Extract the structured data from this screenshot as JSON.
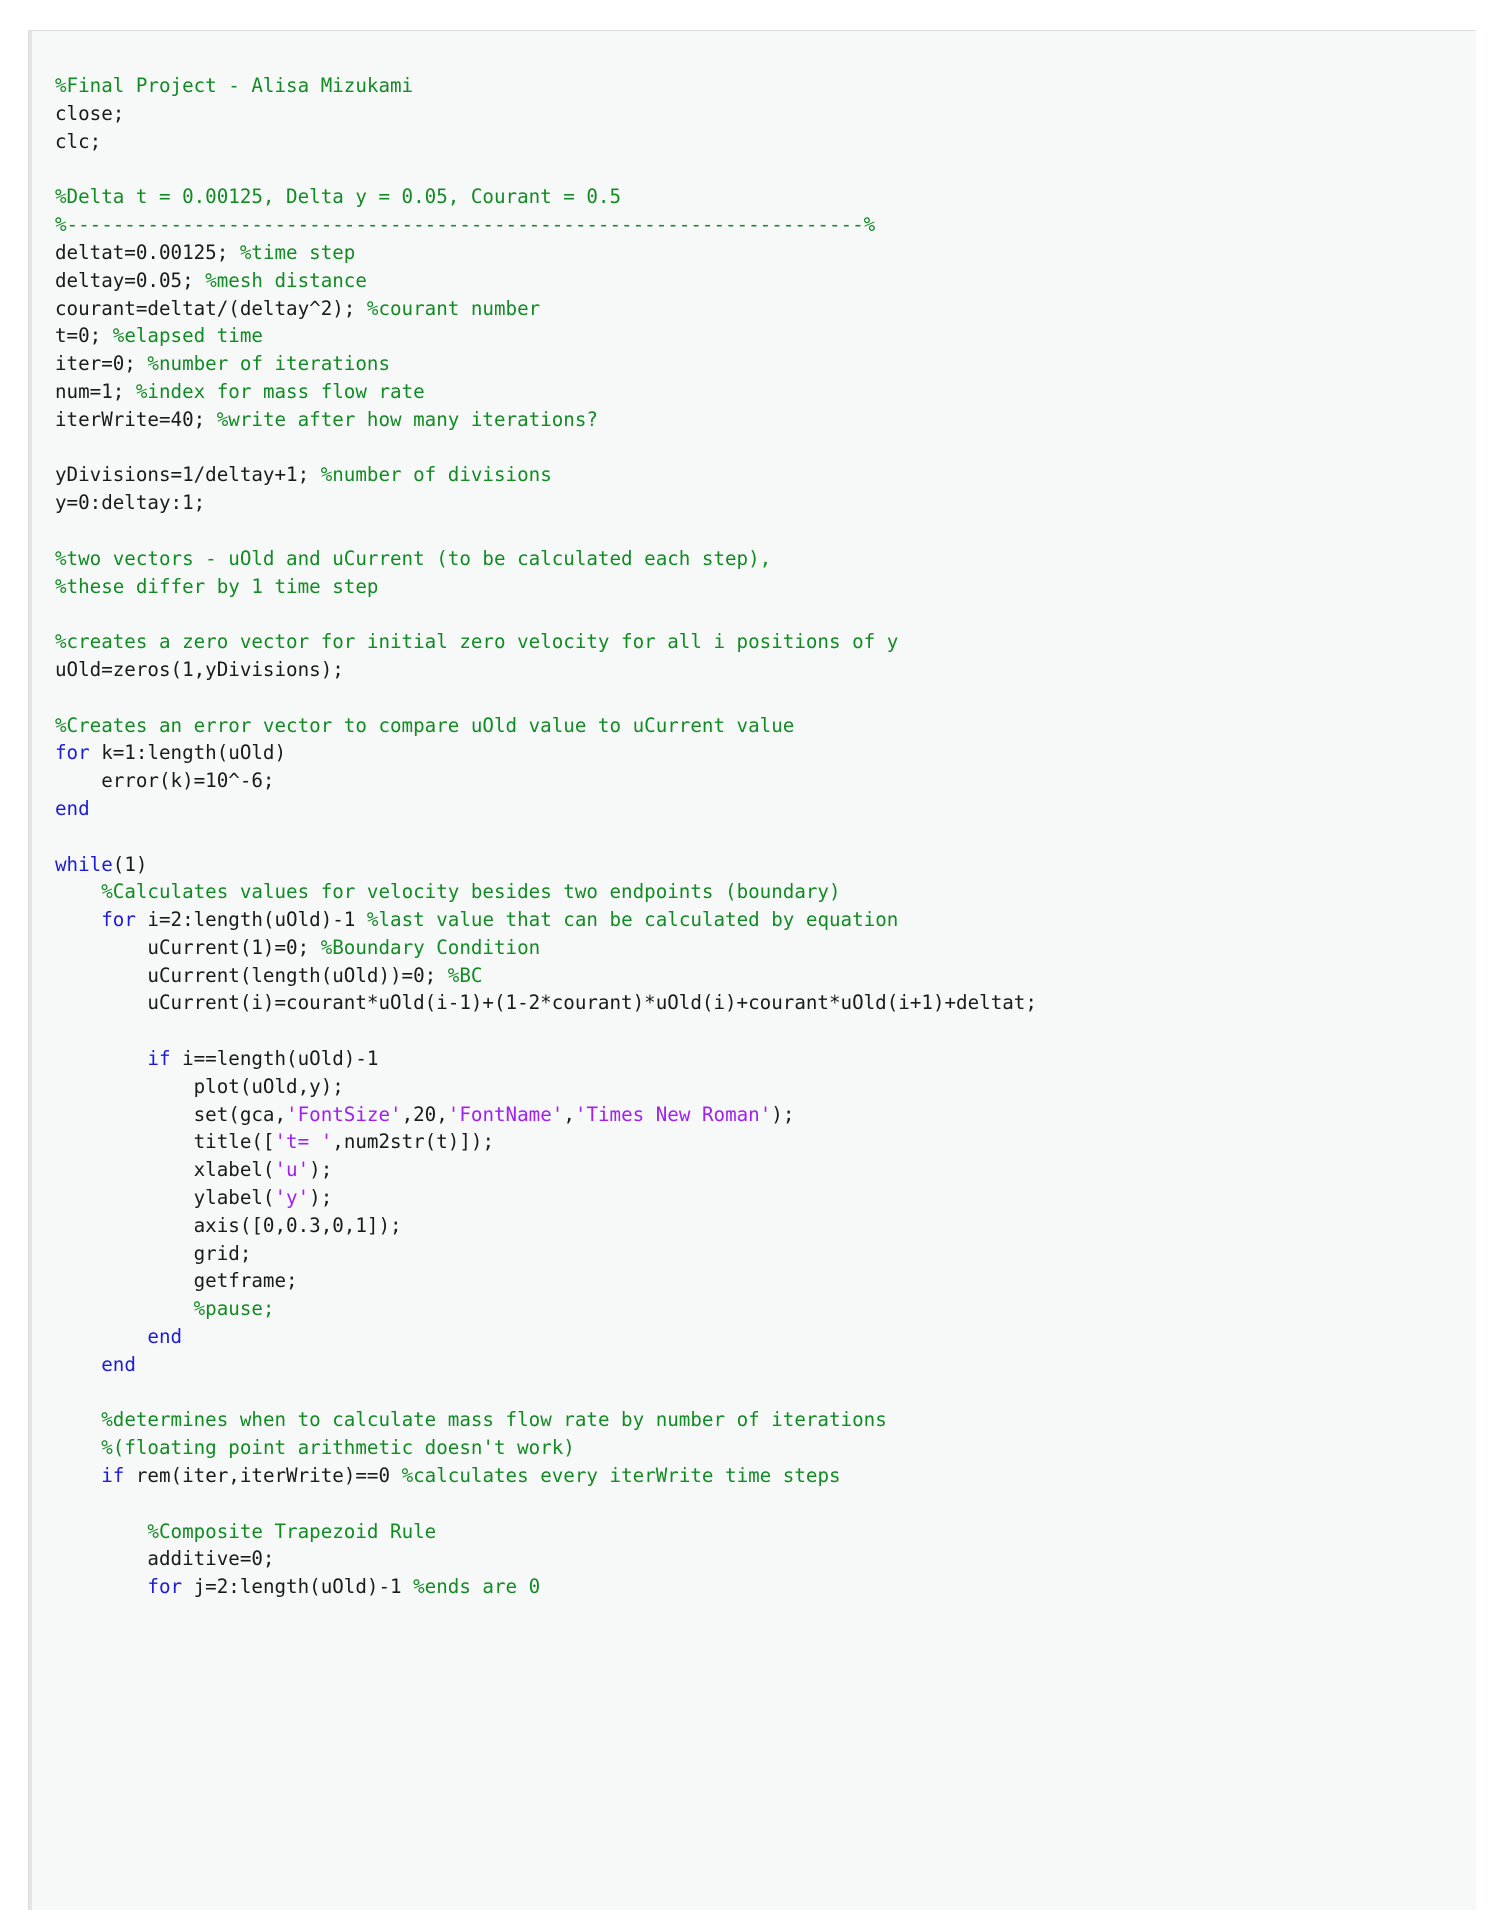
{
  "document": {
    "type": "matlab-code-listing",
    "language": "MATLAB",
    "title": "Final Project - Alisa Mizukami",
    "author": "Alisa Mizukami",
    "colors": {
      "page_background": "#f7f8f8",
      "outer_background": "#ffffff",
      "border": "#dcdddf",
      "comment": "#128b24",
      "keyword": "#1c1cd6",
      "string": "#a020f0",
      "plain": "#1a1a1a"
    }
  },
  "code": {
    "lines": [
      [
        {
          "t": "%Final Project - Alisa Mizukami",
          "c": "cm"
        }
      ],
      [
        {
          "t": "close;",
          "c": "pl"
        }
      ],
      [
        {
          "t": "clc;",
          "c": "pl"
        }
      ],
      [
        {
          "t": "",
          "c": "pl"
        }
      ],
      [
        {
          "t": "%Delta t = 0.00125, Delta y = 0.05, Courant = 0.5",
          "c": "cm"
        }
      ],
      [
        {
          "t": "%---------------------------------------------------------------------%",
          "c": "cm"
        }
      ],
      [
        {
          "t": "deltat=0.00125; ",
          "c": "pl"
        },
        {
          "t": "%time step",
          "c": "cm"
        }
      ],
      [
        {
          "t": "deltay=0.05; ",
          "c": "pl"
        },
        {
          "t": "%mesh distance",
          "c": "cm"
        }
      ],
      [
        {
          "t": "courant=deltat/(deltay^2); ",
          "c": "pl"
        },
        {
          "t": "%courant number",
          "c": "cm"
        }
      ],
      [
        {
          "t": "t=0; ",
          "c": "pl"
        },
        {
          "t": "%elapsed time",
          "c": "cm"
        }
      ],
      [
        {
          "t": "iter=0; ",
          "c": "pl"
        },
        {
          "t": "%number of iterations",
          "c": "cm"
        }
      ],
      [
        {
          "t": "num=1; ",
          "c": "pl"
        },
        {
          "t": "%index for mass flow rate",
          "c": "cm"
        }
      ],
      [
        {
          "t": "iterWrite=40; ",
          "c": "pl"
        },
        {
          "t": "%write after how many iterations?",
          "c": "cm"
        }
      ],
      [
        {
          "t": "",
          "c": "pl"
        }
      ],
      [
        {
          "t": "yDivisions=1/deltay+1; ",
          "c": "pl"
        },
        {
          "t": "%number of divisions",
          "c": "cm"
        }
      ],
      [
        {
          "t": "y=0:deltay:1;",
          "c": "pl"
        }
      ],
      [
        {
          "t": "",
          "c": "pl"
        }
      ],
      [
        {
          "t": "%two vectors - uOld and uCurrent (to be calculated each step),",
          "c": "cm"
        }
      ],
      [
        {
          "t": "%these differ by 1 time step",
          "c": "cm"
        }
      ],
      [
        {
          "t": "",
          "c": "pl"
        }
      ],
      [
        {
          "t": "%creates a zero vector for initial zero velocity for all i positions of y",
          "c": "cm"
        }
      ],
      [
        {
          "t": "uOld=zeros(1,yDivisions);",
          "c": "pl"
        }
      ],
      [
        {
          "t": "",
          "c": "pl"
        }
      ],
      [
        {
          "t": "%Creates an error vector to compare uOld value to uCurrent value",
          "c": "cm"
        }
      ],
      [
        {
          "t": "for",
          "c": "kw"
        },
        {
          "t": " k=1:length(uOld)",
          "c": "pl"
        }
      ],
      [
        {
          "t": "    error(k)=10^-6;",
          "c": "pl"
        }
      ],
      [
        {
          "t": "end",
          "c": "kw"
        }
      ],
      [
        {
          "t": "",
          "c": "pl"
        }
      ],
      [
        {
          "t": "while",
          "c": "kw"
        },
        {
          "t": "(1)",
          "c": "pl"
        }
      ],
      [
        {
          "t": "    ",
          "c": "pl"
        },
        {
          "t": "%Calculates values for velocity besides two endpoints (boundary)",
          "c": "cm"
        }
      ],
      [
        {
          "t": "    ",
          "c": "pl"
        },
        {
          "t": "for",
          "c": "kw"
        },
        {
          "t": " i=2:length(uOld)-1 ",
          "c": "pl"
        },
        {
          "t": "%last value that can be calculated by equation",
          "c": "cm"
        }
      ],
      [
        {
          "t": "        uCurrent(1)=0; ",
          "c": "pl"
        },
        {
          "t": "%Boundary Condition",
          "c": "cm"
        }
      ],
      [
        {
          "t": "        uCurrent(length(uOld))=0; ",
          "c": "pl"
        },
        {
          "t": "%BC",
          "c": "cm"
        }
      ],
      [
        {
          "t": "        uCurrent(i)=courant*uOld(i-1)+(1-2*courant)*uOld(i)+courant*uOld(i+1)+deltat;",
          "c": "pl"
        }
      ],
      [
        {
          "t": "",
          "c": "pl"
        }
      ],
      [
        {
          "t": "        ",
          "c": "pl"
        },
        {
          "t": "if",
          "c": "kw"
        },
        {
          "t": " i==length(uOld)-1",
          "c": "pl"
        }
      ],
      [
        {
          "t": "            plot(uOld,y);",
          "c": "pl"
        }
      ],
      [
        {
          "t": "            set(gca,",
          "c": "pl"
        },
        {
          "t": "'FontSize'",
          "c": "st"
        },
        {
          "t": ",20,",
          "c": "pl"
        },
        {
          "t": "'FontName'",
          "c": "st"
        },
        {
          "t": ",",
          "c": "pl"
        },
        {
          "t": "'Times New Roman'",
          "c": "st"
        },
        {
          "t": ");",
          "c": "pl"
        }
      ],
      [
        {
          "t": "            title([",
          "c": "pl"
        },
        {
          "t": "'t= '",
          "c": "st"
        },
        {
          "t": ",num2str(t)]);",
          "c": "pl"
        }
      ],
      [
        {
          "t": "            xlabel(",
          "c": "pl"
        },
        {
          "t": "'u'",
          "c": "st"
        },
        {
          "t": ");",
          "c": "pl"
        }
      ],
      [
        {
          "t": "            ylabel(",
          "c": "pl"
        },
        {
          "t": "'y'",
          "c": "st"
        },
        {
          "t": ");",
          "c": "pl"
        }
      ],
      [
        {
          "t": "            axis([0,0.3,0,1]);",
          "c": "pl"
        }
      ],
      [
        {
          "t": "            grid;",
          "c": "pl"
        }
      ],
      [
        {
          "t": "            getframe;",
          "c": "pl"
        }
      ],
      [
        {
          "t": "            ",
          "c": "pl"
        },
        {
          "t": "%pause;",
          "c": "cm"
        }
      ],
      [
        {
          "t": "        ",
          "c": "pl"
        },
        {
          "t": "end",
          "c": "kw"
        }
      ],
      [
        {
          "t": "    ",
          "c": "pl"
        },
        {
          "t": "end",
          "c": "kw"
        }
      ],
      [
        {
          "t": "",
          "c": "pl"
        }
      ],
      [
        {
          "t": "    ",
          "c": "pl"
        },
        {
          "t": "%determines when to calculate mass flow rate by number of iterations",
          "c": "cm"
        }
      ],
      [
        {
          "t": "    ",
          "c": "pl"
        },
        {
          "t": "%(floating point arithmetic doesn't work)",
          "c": "cm"
        }
      ],
      [
        {
          "t": "    ",
          "c": "pl"
        },
        {
          "t": "if",
          "c": "kw"
        },
        {
          "t": " rem(iter,iterWrite)==0 ",
          "c": "pl"
        },
        {
          "t": "%calculates every iterWrite time steps",
          "c": "cm"
        }
      ],
      [
        {
          "t": "",
          "c": "pl"
        }
      ],
      [
        {
          "t": "        ",
          "c": "pl"
        },
        {
          "t": "%Composite Trapezoid Rule",
          "c": "cm"
        }
      ],
      [
        {
          "t": "        additive=0;",
          "c": "pl"
        }
      ],
      [
        {
          "t": "        ",
          "c": "pl"
        },
        {
          "t": "for",
          "c": "kw"
        },
        {
          "t": " j=2:length(uOld)-1 ",
          "c": "pl"
        },
        {
          "t": "%ends are 0",
          "c": "cm"
        }
      ]
    ]
  }
}
